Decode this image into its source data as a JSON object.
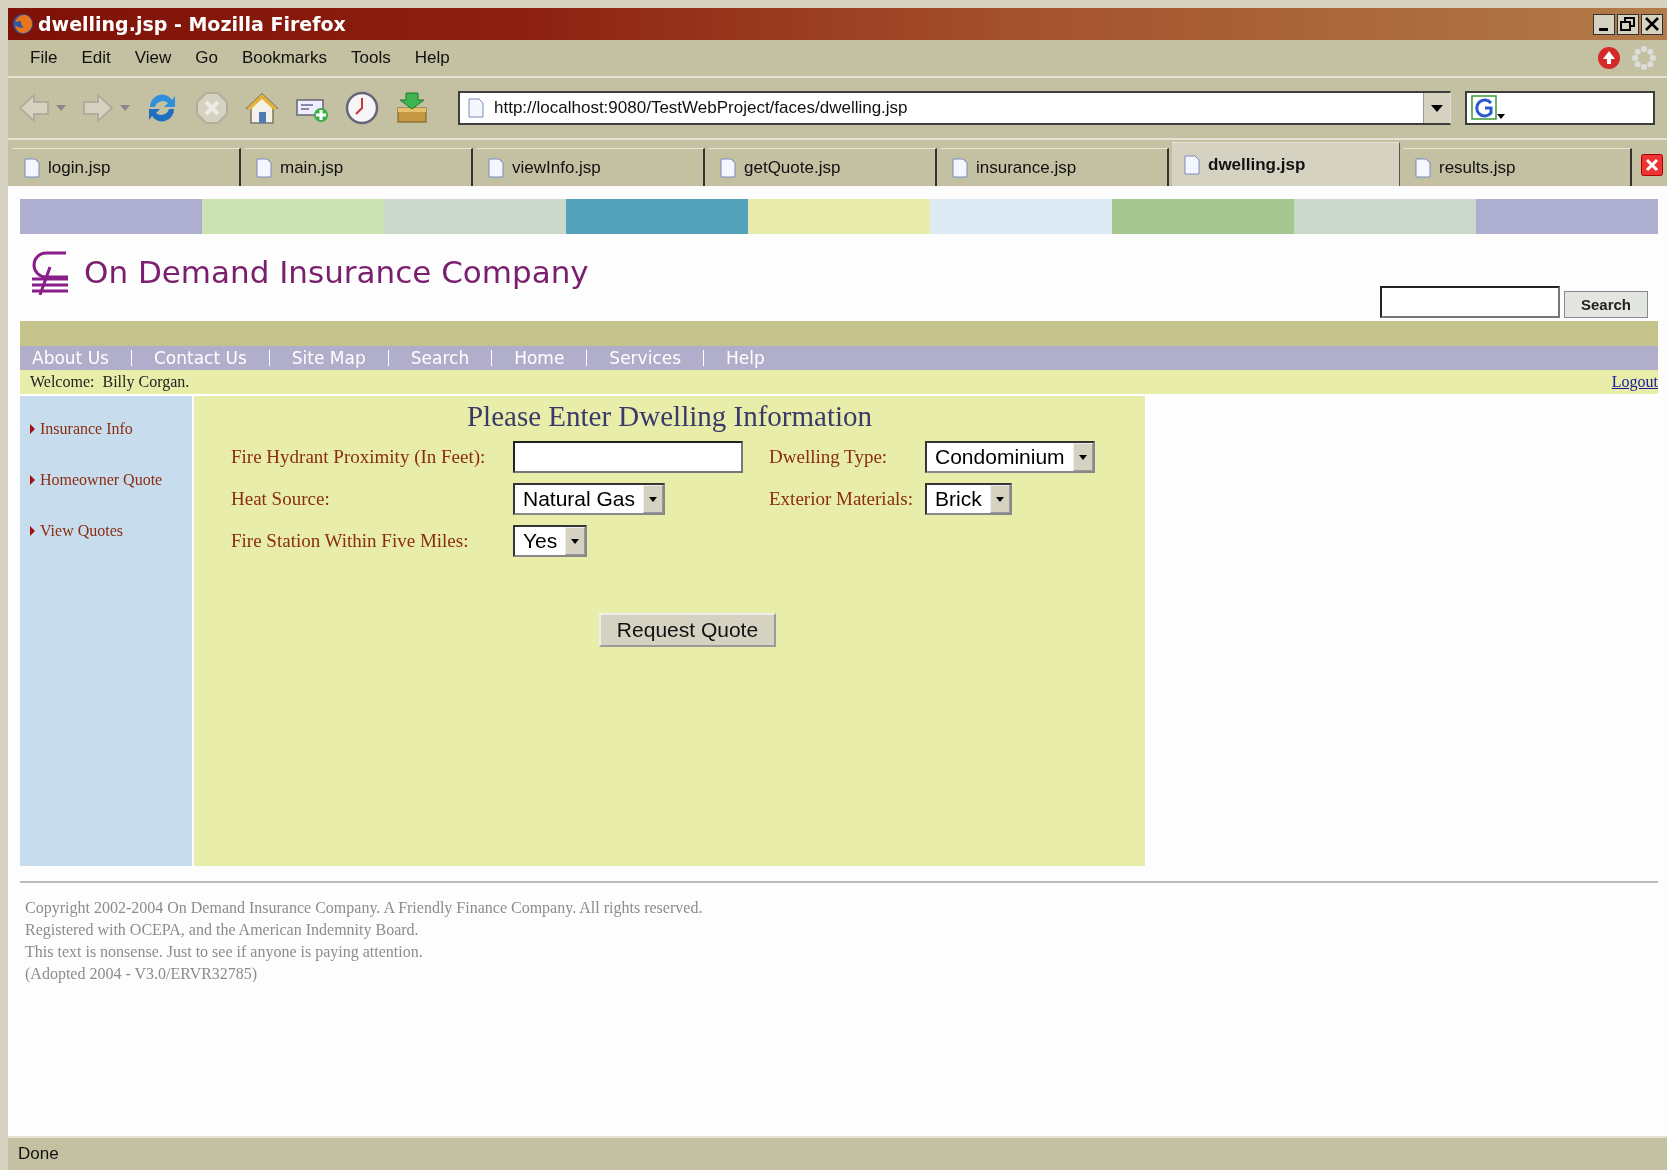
{
  "window": {
    "title": "dwelling.jsp - Mozilla Firefox"
  },
  "menu": [
    "File",
    "Edit",
    "View",
    "Go",
    "Bookmarks",
    "Tools",
    "Help"
  ],
  "toolbar": [
    {
      "kind": "back",
      "disabled": true
    },
    {
      "kind": "forward",
      "disabled": true
    },
    {
      "kind": "reload",
      "disabled": false
    },
    {
      "kind": "stop",
      "disabled": true
    },
    {
      "kind": "home",
      "disabled": false
    },
    {
      "kind": "bookmark-add",
      "disabled": false
    },
    {
      "kind": "history",
      "disabled": false
    },
    {
      "kind": "download",
      "disabled": false
    }
  ],
  "address": {
    "value": "http://localhost:9080/TestWebProject/faces/dwelling.jsp"
  },
  "tabs": [
    {
      "label": "login.jsp",
      "selected": false
    },
    {
      "label": "main.jsp",
      "selected": false
    },
    {
      "label": "viewInfo.jsp",
      "selected": false
    },
    {
      "label": "getQuote.jsp",
      "selected": false
    },
    {
      "label": "insurance.jsp",
      "selected": false
    },
    {
      "label": "dwelling.jsp",
      "selected": true
    },
    {
      "label": "results.jsp",
      "selected": false
    }
  ],
  "page": {
    "color_strip": [
      {
        "color": "#aeaed0"
      },
      {
        "color": "#cde3b4"
      },
      {
        "color": "#cbd9cc"
      },
      {
        "color": "#55a3bb"
      },
      {
        "color": "#e7ecac"
      },
      {
        "color": "#deeaf4"
      },
      {
        "color": "#a7c791"
      },
      {
        "color": "#cbd9cc"
      },
      {
        "color": "#aeaed0"
      }
    ],
    "company": "On Demand Insurance Company",
    "search_button": "Search",
    "nav": [
      "About Us",
      "Contact Us",
      "Site Map",
      "Search",
      "Home",
      "Services",
      "Help"
    ],
    "welcome": "Welcome:  Billy Corgan.",
    "logout": "Logout",
    "sidebar": [
      "Insurance Info",
      "Homeowner Quote",
      "View Quotes"
    ],
    "form": {
      "heading": "Please Enter Dwelling Information",
      "fields": [
        {
          "label": "Fire Hydrant Proximity (In Feet):",
          "kind": "text"
        },
        {
          "label": "Dwelling Type:",
          "kind": "select",
          "value": "Condominium"
        },
        {
          "label": "Heat Source:",
          "kind": "select",
          "value": "Natural Gas"
        },
        {
          "label": "Exterior Materials:",
          "kind": "select",
          "value": "Brick"
        },
        {
          "label": "Fire Station Within Five Miles:",
          "kind": "select",
          "value": "Yes"
        }
      ],
      "submit": "Request Quote"
    },
    "footer": [
      "Copyright 2002-2004 On Demand Insurance Company. A Friendly Finance Company. All rights reserved.",
      "Registered with OCEPA, and the American Indemnity Board.",
      "This text is nonsense. Just to see if anyone is paying attention.",
      "(Adopted 2004 - V3.0/ERVR32785)"
    ]
  },
  "status_bar": "Done"
}
